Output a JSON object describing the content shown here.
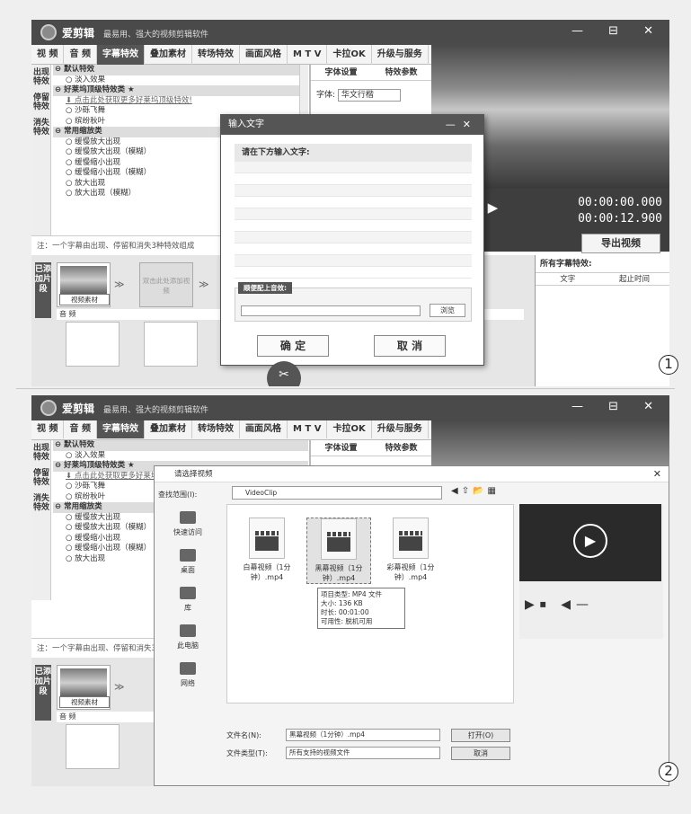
{
  "app": {
    "name": "爱剪辑",
    "slogan": "最易用、强大的视频剪辑软件",
    "win_controls": "— ⊟ ✕"
  },
  "menu": [
    "视 频",
    "音 频",
    "字幕特效",
    "叠加素材",
    "转场特效",
    "画面风格",
    "M T V",
    "卡拉OK",
    "升级与服务"
  ],
  "vtabs": [
    "出现特效",
    "停留特效",
    "消失特效"
  ],
  "fx_items": [
    {
      "t": "⊖ 默认特效",
      "k": "group"
    },
    {
      "t": "淡入效果",
      "k": "radio"
    },
    {
      "t": "⊖ 好莱坞顶级特效类 ★",
      "k": "group"
    },
    {
      "t": "⬇ 点击此处获取更多好莱坞顶级特效!",
      "k": "link"
    },
    {
      "t": "沙砾飞舞",
      "k": "radio"
    },
    {
      "t": "缤纷秋叶",
      "k": "radio"
    },
    {
      "t": "⊖ 常用缩放类",
      "k": "group"
    },
    {
      "t": "缓慢放大出现",
      "k": "radio"
    },
    {
      "t": "缓慢放大出现（模糊）",
      "k": "radio"
    },
    {
      "t": "缓慢缩小出现",
      "k": "radio"
    },
    {
      "t": "缓慢缩小出现（模糊）",
      "k": "radio"
    },
    {
      "t": "放大出现",
      "k": "radio"
    },
    {
      "t": "放大出现（模糊）",
      "k": "radio"
    }
  ],
  "settings": {
    "tab1": "字体设置",
    "tab2": "特效参数",
    "font_label": "字体:",
    "font_value": "华文行楷"
  },
  "note": "注：一个字幕由出现、停留和消失3种特效组成",
  "time": {
    "current": "00:00:00.000",
    "total": "00:00:12.900"
  },
  "export_label": "导出视频",
  "track": {
    "label": "已添加片段",
    "clip_label": "视频素材",
    "add_hint": "双击此处添加视频",
    "audio": "音 频"
  },
  "right": {
    "title": "所有字幕特效:",
    "col1": "文字",
    "col2": "起止时间"
  },
  "dialog1": {
    "title": "输入文字",
    "prompt": "请在下方输入文字:",
    "sound": "顺便配上音效:",
    "browse": "浏览",
    "ok": "确 定",
    "cancel": "取 消"
  },
  "dialog2": {
    "title": "请选择视频",
    "look_in": "查找范围(I):",
    "folder": "VideoClip",
    "nav": [
      "快速访问",
      "桌面",
      "库",
      "此电脑",
      "网络"
    ],
    "files": [
      "白幕视频（1分钟）.mp4",
      "黑幕视频（1分钟）.mp4",
      "彩幕视频（1分钟）.mp4"
    ],
    "tooltip": [
      "项目类型: MP4 文件",
      "大小: 136 KB",
      "时长: 00:01:00",
      "可用性: 脱机可用"
    ],
    "filename_label": "文件名(N):",
    "filename": "黑幕视频（1分钟）.mp4",
    "filetype_label": "文件类型(T):",
    "filetype": "所有支持的视频文件",
    "open": "打开(O)",
    "cancel": "取消"
  },
  "labels": [
    "1",
    "2"
  ]
}
